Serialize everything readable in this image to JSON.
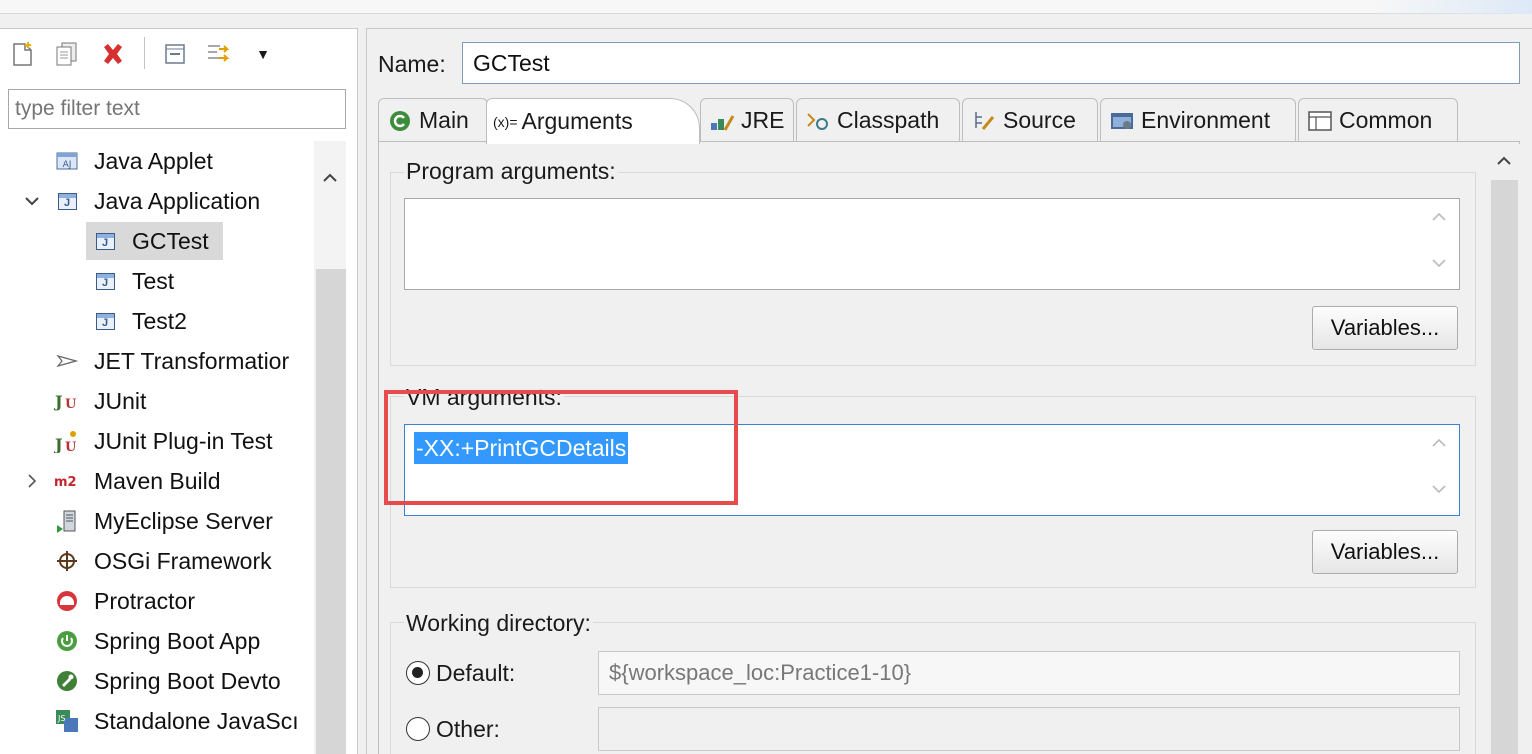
{
  "left": {
    "filter_placeholder": "type filter text",
    "toolbar": {
      "new_icon": "new-launch-config-icon",
      "duplicate_icon": "duplicate-icon",
      "delete_icon": "delete-icon",
      "collapse_icon": "collapse-all-icon",
      "filter_icon": "filter-icon",
      "dropdown_icon": "dropdown-icon"
    },
    "tree": [
      {
        "label": "Java Applet",
        "icon": "java-applet-icon"
      },
      {
        "label": "Java Application",
        "icon": "java-application-icon",
        "expanded": true
      },
      {
        "label": "GCTest",
        "icon": "java-launch-icon",
        "selected": true
      },
      {
        "label": "Test",
        "icon": "java-launch-icon"
      },
      {
        "label": "Test2",
        "icon": "java-launch-icon"
      },
      {
        "label": "JET Transformatior",
        "icon": "jet-icon"
      },
      {
        "label": "JUnit",
        "icon": "junit-icon"
      },
      {
        "label": "JUnit Plug-in Test",
        "icon": "junit-plugin-icon"
      },
      {
        "label": "Maven Build",
        "icon": "maven-icon",
        "expanded": false
      },
      {
        "label": "MyEclipse Server",
        "icon": "server-icon"
      },
      {
        "label": "OSGi Framework",
        "icon": "osgi-icon"
      },
      {
        "label": "Protractor",
        "icon": "protractor-icon"
      },
      {
        "label": "Spring Boot App",
        "icon": "spring-boot-icon"
      },
      {
        "label": "Spring Boot Devto",
        "icon": "spring-devtools-icon"
      },
      {
        "label": "Standalone JavaScı",
        "icon": "standalone-js-icon"
      }
    ]
  },
  "right": {
    "name_label": "Name:",
    "name_value": "GCTest",
    "tabs": [
      {
        "label": "Main",
        "icon": "main-tab-icon"
      },
      {
        "label": "Arguments",
        "icon": "arguments-tab-icon",
        "prefix": "(x)=",
        "active": true
      },
      {
        "label": "JRE",
        "icon": "jre-tab-icon"
      },
      {
        "label": "Classpath",
        "icon": "classpath-tab-icon"
      },
      {
        "label": "Source",
        "icon": "source-tab-icon"
      },
      {
        "label": "Environment",
        "icon": "environment-tab-icon"
      },
      {
        "label": "Common",
        "icon": "common-tab-icon"
      }
    ],
    "program_args": {
      "title": "Program arguments:",
      "value": "",
      "variables_button": "Variables..."
    },
    "vm_args": {
      "title": "VM arguments:",
      "value": "-XX:+PrintGCDetails",
      "variables_button": "Variables..."
    },
    "working_dir": {
      "title": "Working directory:",
      "default_label": "Default:",
      "default_value": "${workspace_loc:Practice1-10}",
      "other_label": "Other:",
      "other_value": "",
      "selected": "Default"
    }
  },
  "colors": {
    "selection": "#3399ff",
    "highlight_box": "#e74b4b",
    "tree_selection": "#d9d9d9"
  }
}
